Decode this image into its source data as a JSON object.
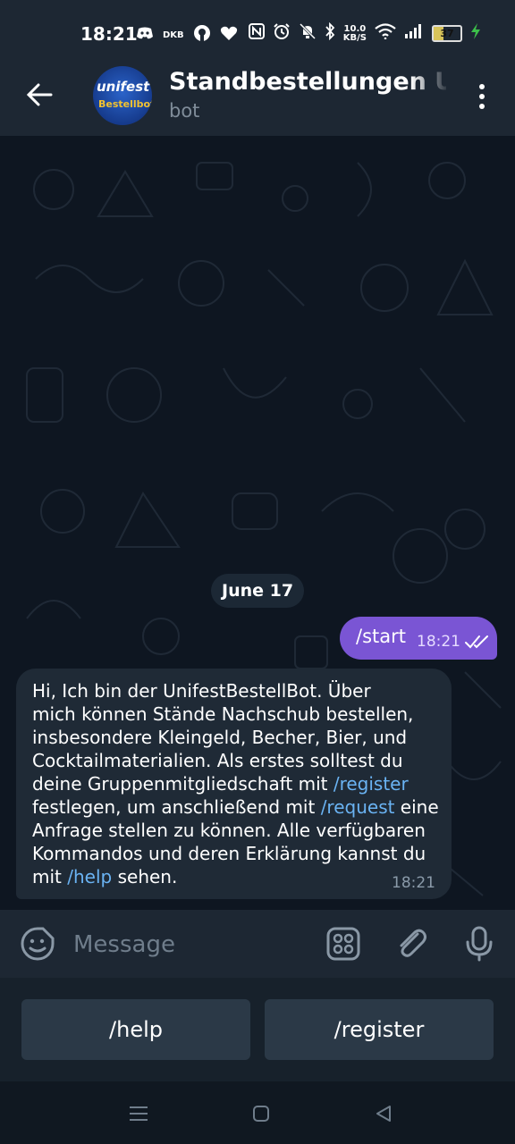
{
  "status_bar": {
    "time": "18:21",
    "bank_label": "DKB",
    "net_speed_value": "10.0",
    "net_speed_unit": "KB/S",
    "battery_level": "37",
    "battery_fraction": 0.37,
    "icons_left": [
      "discord-icon",
      "github-icon",
      "heart-icon"
    ],
    "icons_right": [
      "nfc-icon",
      "alarm-icon",
      "mute-icon",
      "bluetooth-icon",
      "wifi-icon",
      "signal-icon",
      "battery-icon",
      "charging-icon"
    ]
  },
  "header": {
    "title": "Standbestellungen Unifest",
    "subtitle": "bot",
    "avatar": {
      "line1": "unifest",
      "line2": "Bestellbot"
    }
  },
  "chat": {
    "date": "June 17",
    "outgoing": {
      "text": "/start",
      "time": "18:21"
    },
    "incoming": {
      "part1": "Hi, Ich bin der UnifestBestellBot. Über\nmich können Stände Nachschub bestellen,\ninsbesondere Kleingeld, Becher, Bier, und\nCocktailmaterialien. Als erstes solltest du\ndeine Gruppenmitgliedschaft mit ",
      "cmd1": "/register",
      "part2": "\nfestlegen, um anschließend mit ",
      "cmd2": "/request",
      "part3": " eine\nAnfrage stellen zu können. Alle verfügbaren\nKommandos und deren Erklärung kannst du\nmit ",
      "cmd3": "/help",
      "part4": " sehen.",
      "time": "18:21"
    }
  },
  "input": {
    "placeholder": "Message"
  },
  "keyboard": {
    "buttons": [
      "/help",
      "/register"
    ]
  },
  "colors": {
    "accent": "#7a55d4",
    "link": "#6ab3f3",
    "background": "#0e1621",
    "header": "#1d2733"
  }
}
